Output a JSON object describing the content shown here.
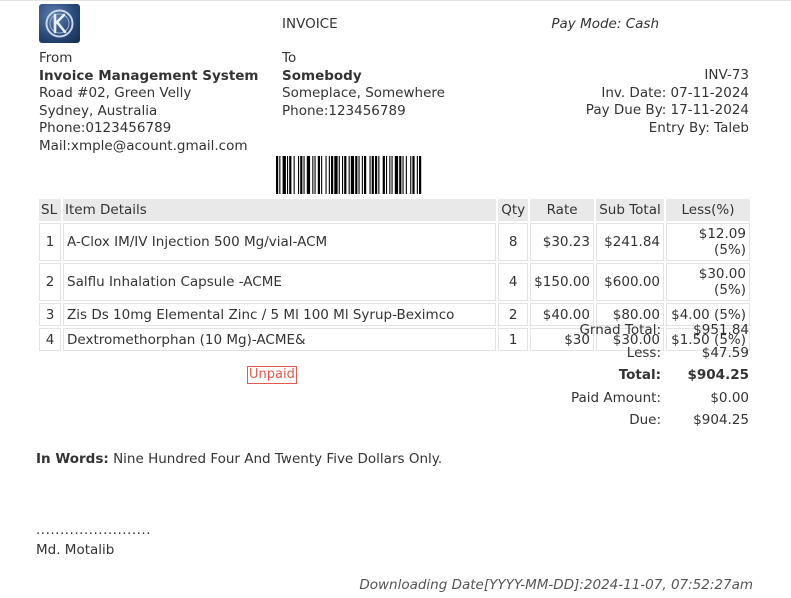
{
  "header": {
    "logo_text": "TK",
    "doc_title": "INVOICE",
    "pay_mode": "Pay Mode: Cash"
  },
  "from": {
    "label": "From",
    "name": "Invoice Management System",
    "address1": "Road #02, Green Velly",
    "address2": "Sydney, Australia",
    "phone": "Phone:0123456789",
    "mail": "Mail:xmple@acount.gmail.com"
  },
  "to": {
    "label": "To",
    "name": "Somebody",
    "address": "Someplace, Somewhere",
    "phone": "Phone:123456789"
  },
  "invoice": {
    "number": "INV-73",
    "date": "Inv. Date: 07-11-2024",
    "due": "Pay Due By: 17-11-2024",
    "entry": "Entry By: Taleb"
  },
  "table": {
    "headers": [
      "SL",
      "Item Details",
      "Qty",
      "Rate",
      "Sub Total",
      "Less(%)"
    ],
    "rows": [
      {
        "sl": "1",
        "item": "A-Clox IM/IV Injection 500 Mg/vial-ACM",
        "qty": "8",
        "rate": "$30.23",
        "subtotal": "$241.84",
        "less": "$12.09 (5%)"
      },
      {
        "sl": "2",
        "item": "Salflu Inhalation Capsule -ACME",
        "qty": "4",
        "rate": "$150.00",
        "subtotal": "$600.00",
        "less": "$30.00 (5%)"
      },
      {
        "sl": "3",
        "item": "Zis Ds 10mg Elemental Zinc / 5 Ml 100 Ml Syrup-Beximco",
        "qty": "2",
        "rate": "$40.00",
        "subtotal": "$80.00",
        "less": "$4.00 (5%)"
      },
      {
        "sl": "4",
        "item": "Dextromethorphan (10 Mg)-ACME&",
        "qty": "1",
        "rate": "$30",
        "subtotal": "$30.00",
        "less": "$1.50 (5%)"
      }
    ]
  },
  "totals": {
    "grand_label": "Grnad Total:",
    "grand_value": "$951.84",
    "less_label": "Less:",
    "less_value": "$47.59",
    "total_label": "Total:",
    "total_value": "$904.25",
    "paid_label": "Paid Amount:",
    "paid_value": "$0.00",
    "due_label": "Due:",
    "due_value": "$904.25"
  },
  "status": "Unpaid",
  "in_words": {
    "label": "In Words:",
    "text": " Nine Hundred Four And Twenty Five Dollars Only."
  },
  "signature": {
    "dots": "........................",
    "name": "Md. Motalib"
  },
  "footer": "Downloading Date[YYYY-MM-DD]:2024-11-07, 07:52:27am",
  "colors": {
    "header_bg": "#e9e9e9",
    "status_red": "#e05a4e",
    "text": "#333333"
  }
}
